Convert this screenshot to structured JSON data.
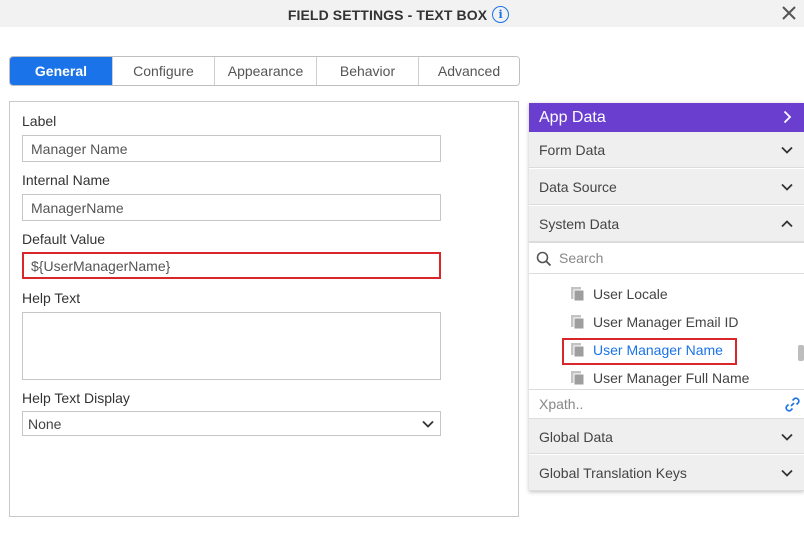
{
  "dialog": {
    "title": "FIELD SETTINGS - TEXT BOX",
    "close_icon": "close-icon",
    "info_icon": "info-icon"
  },
  "tabs": [
    {
      "label": "General",
      "active": true
    },
    {
      "label": "Configure",
      "active": false
    },
    {
      "label": "Appearance",
      "active": false
    },
    {
      "label": "Behavior",
      "active": false
    },
    {
      "label": "Advanced",
      "active": false
    }
  ],
  "form": {
    "label": {
      "caption": "Label",
      "value": "Manager Name"
    },
    "internal_name": {
      "caption": "Internal Name",
      "value": "ManagerName"
    },
    "default_value": {
      "caption": "Default Value",
      "value": "${UserManagerName}"
    },
    "help_text": {
      "caption": "Help Text",
      "value": ""
    },
    "help_text_display": {
      "caption": "Help Text Display",
      "selected": "None"
    }
  },
  "app_data": {
    "title": "App Data",
    "sections": {
      "form_data": "Form Data",
      "data_source": "Data Source",
      "system_data": "System Data",
      "global_data": "Global Data",
      "global_translation_keys": "Global Translation Keys"
    },
    "search_placeholder": "Search",
    "items": [
      "User Locale",
      "User Manager Email ID",
      "User Manager Name",
      "User Manager Full Name"
    ],
    "selected_item": "User Manager Name",
    "xpath_placeholder": "Xpath.."
  },
  "colors": {
    "accent": "#1a73e8",
    "header": "#6a3fd0",
    "highlight": "#d9262b"
  }
}
